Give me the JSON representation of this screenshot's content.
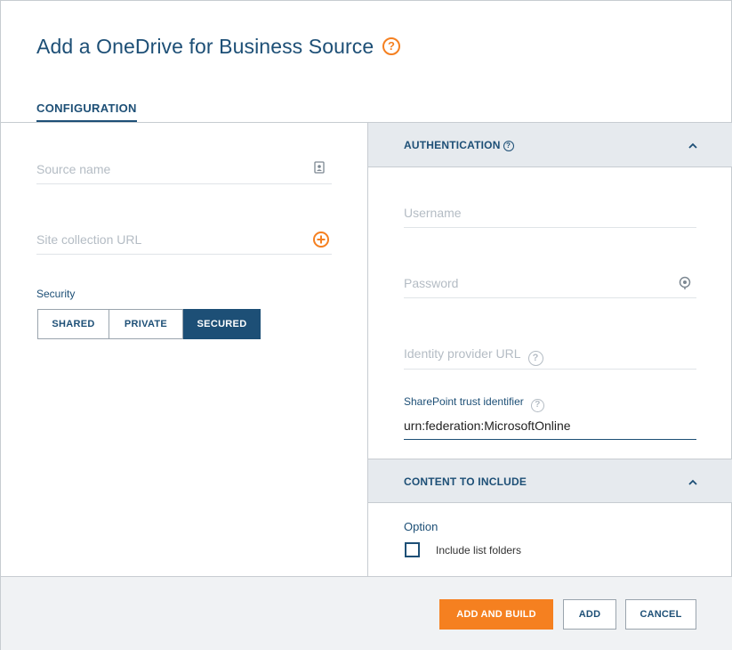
{
  "title": "Add a OneDrive for Business Source",
  "tabs": [
    {
      "label": "CONFIGURATION"
    }
  ],
  "left": {
    "source_name_placeholder": "Source name",
    "site_collection_placeholder": "Site collection URL",
    "security_label": "Security",
    "security_options": [
      "SHARED",
      "PRIVATE",
      "SECURED"
    ],
    "security_selected": "SECURED"
  },
  "authentication": {
    "title": "AUTHENTICATION",
    "username_placeholder": "Username",
    "password_placeholder": "Password",
    "identity_provider_placeholder": "Identity provider URL",
    "sharepoint_label": "SharePoint trust identifier",
    "sharepoint_value": "urn:federation:MicrosoftOnline"
  },
  "content": {
    "title": "CONTENT TO INCLUDE",
    "option_label": "Option",
    "include_list_folders_label": "Include list folders",
    "include_list_folders_checked": false
  },
  "footer": {
    "add_and_build": "ADD AND BUILD",
    "add": "ADD",
    "cancel": "CANCEL"
  },
  "colors": {
    "primary": "#1d4f76",
    "accent": "#f58020"
  }
}
